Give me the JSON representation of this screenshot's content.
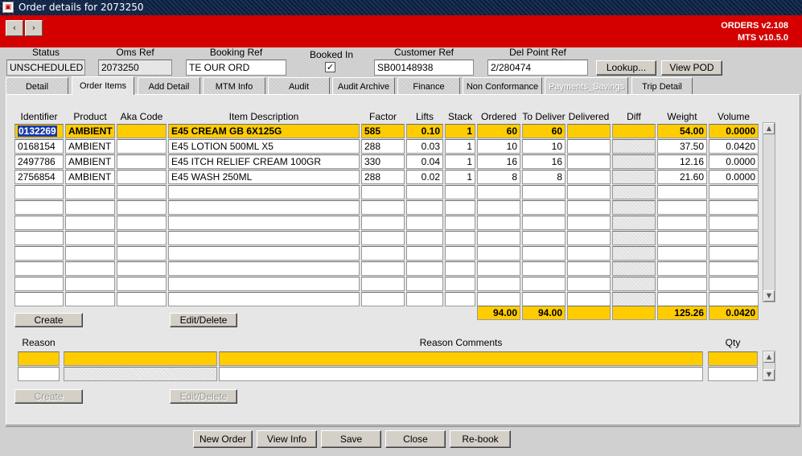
{
  "window": {
    "title": "Order details for 2073250"
  },
  "header": {
    "back_label": "‹",
    "forward_label": "›",
    "version_orders": "ORDERS v2.108",
    "version_mts": "MTS v10.5.0"
  },
  "order": {
    "status_label": "Status",
    "status": "UNSCHEDULED",
    "oms_ref_label": "Oms Ref",
    "oms_ref": "2073250",
    "booking_ref_label": "Booking Ref",
    "booking_ref": "TE OUR ORD",
    "booked_in_label": "Booked In",
    "booked_in_check": "✓",
    "customer_ref_label": "Customer Ref",
    "customer_ref": "SB00148938",
    "del_point_ref_label": "Del Point Ref",
    "del_point_ref": "2/280474",
    "lookup_label": "Lookup...",
    "view_pod_label": "View POD"
  },
  "tabs": [
    "Detail",
    "Order Items",
    "Add Detail",
    "MTM Info",
    "Audit",
    "Audit Archive",
    "Finance",
    "Non Conformance",
    "Payments_Savings",
    "Trip Detail"
  ],
  "items": {
    "columns": [
      "Identifier",
      "Product",
      "Aka Code",
      "Item Description",
      "Factor",
      "Lifts",
      "Stack",
      "Ordered",
      "To Deliver",
      "Delivered",
      "Diff",
      "Weight",
      "Volume"
    ],
    "rows": [
      [
        "0132269",
        "AMBIENT",
        "",
        "E45 CREAM GB 6X125G",
        "585",
        "0.10",
        "1",
        "60",
        "60",
        "",
        "",
        "54.00",
        "0.0000"
      ],
      [
        "0168154",
        "AMBIENT",
        "",
        "E45 LOTION 500ML X5",
        "288",
        "0.03",
        "1",
        "10",
        "10",
        "",
        "",
        "37.50",
        "0.0420"
      ],
      [
        "2497786",
        "AMBIENT",
        "",
        "E45 ITCH RELIEF CREAM 100GR",
        "330",
        "0.04",
        "1",
        "16",
        "16",
        "",
        "",
        "12.16",
        "0.0000"
      ],
      [
        "2756854",
        "AMBIENT",
        "",
        "E45 WASH 250ML",
        "288",
        "0.02",
        "1",
        "8",
        "8",
        "",
        "",
        "21.60",
        "0.0000"
      ]
    ],
    "totals": {
      "ordered": "94.00",
      "to_deliver": "94.00",
      "delivered": "",
      "diff": "",
      "weight": "125.26",
      "volume": "0.0420"
    },
    "create_label": "Create",
    "edit_delete_label": "Edit/Delete"
  },
  "reasons": {
    "reason_label": "Reason",
    "comments_label": "Reason Comments",
    "qty_label": "Qty",
    "create_label": "Create",
    "edit_delete_label": "Edit/Delete"
  },
  "footer": {
    "new_order": "New Order",
    "view_info": "View Info",
    "save": "Save",
    "close": "Close",
    "rebook": "Re-book"
  },
  "colors": {
    "header_red": "#d40000",
    "highlight": "#ffcc00",
    "title_bar": "#14284a"
  }
}
